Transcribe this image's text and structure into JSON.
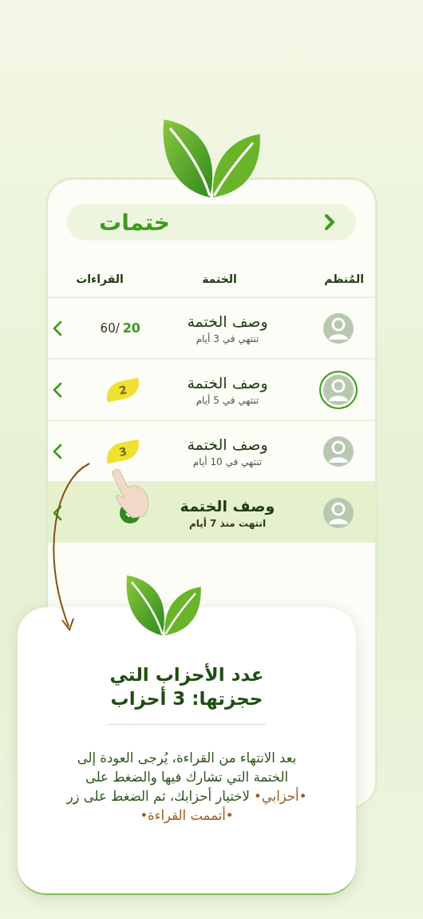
{
  "header": {
    "title": "ختمات"
  },
  "columns": [
    "المُنظم",
    "الختمة",
    "القراءات"
  ],
  "rows": [
    {
      "title": "وصف الختمة",
      "subtitle": "تنتهي في 3 أيام",
      "avatar_ringed": false,
      "finished": false,
      "readings": {
        "kind": "count",
        "done": "20",
        "total": "60/"
      }
    },
    {
      "title": "وصف الختمة",
      "subtitle": "تنتهي في 5 أيام",
      "avatar_ringed": true,
      "finished": false,
      "readings": {
        "kind": "leaf",
        "value": "2"
      }
    },
    {
      "title": "وصف الختمة",
      "subtitle": "تنتهي في 10 أيام",
      "avatar_ringed": false,
      "finished": false,
      "readings": {
        "kind": "leaf",
        "value": "3"
      }
    },
    {
      "title": "وصف الختمة",
      "subtitle": "انتهت منذ 7 أيام",
      "avatar_ringed": false,
      "finished": true,
      "readings": {
        "kind": "check"
      }
    }
  ],
  "tip": {
    "title": "عدد الأحزاب التي حجزتها: 3 أحزاب",
    "body": [
      {
        "kind": "plain",
        "text": "بعد الانتهاء من القراءة، يُرجى العودة إلى الختمة التي تشارك فيها والضغط على "
      },
      {
        "kind": "highlight",
        "text": "•أحزابي•"
      },
      {
        "kind": "plain",
        "text": " لاختيار أحزابك، ثم الضغط على زر "
      },
      {
        "kind": "highlight",
        "text": "•أتممت القراءة•"
      }
    ]
  }
}
